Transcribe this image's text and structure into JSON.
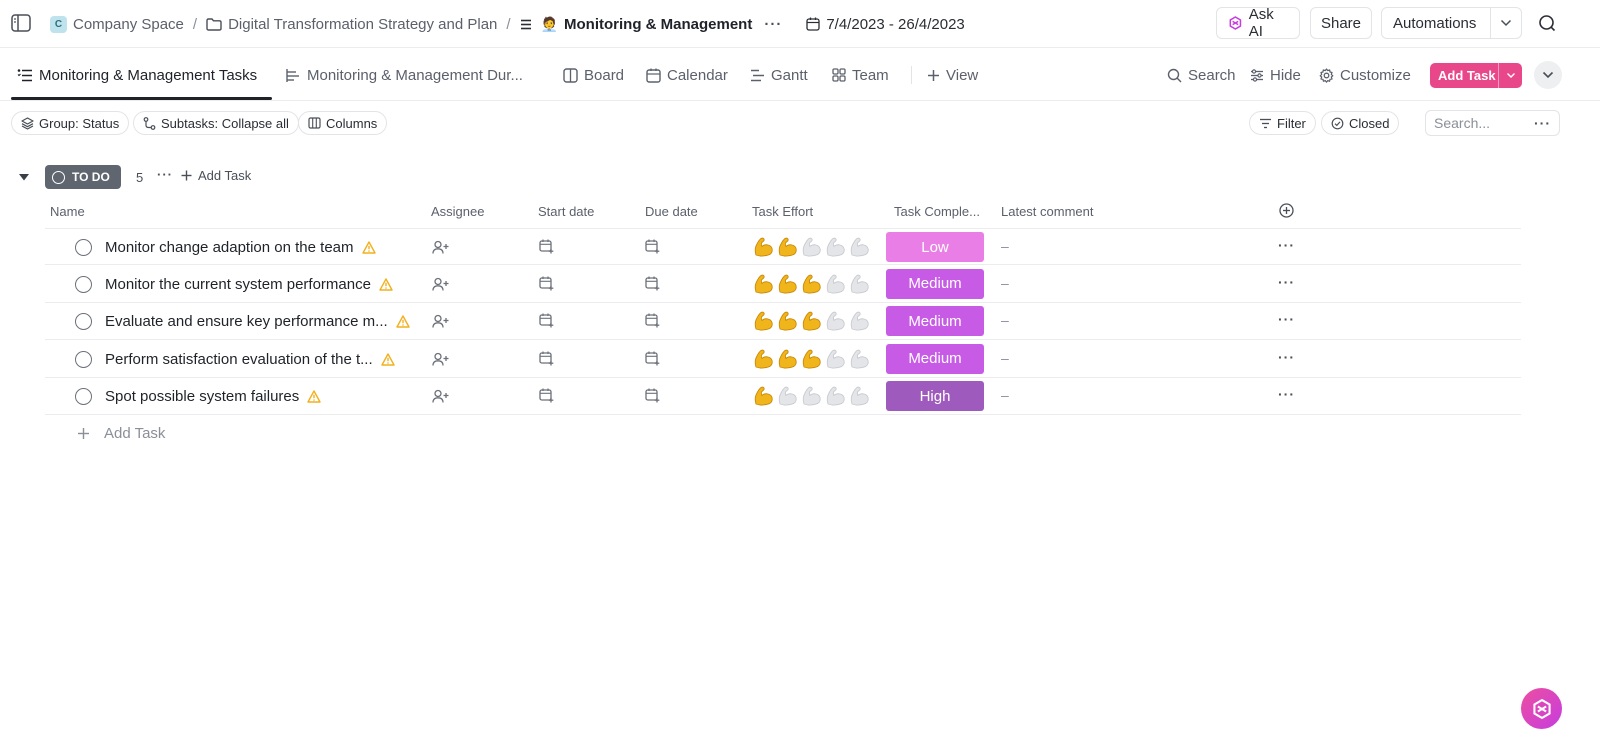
{
  "breadcrumb": {
    "space_initial": "C",
    "space": "Company Space",
    "separator": "/",
    "folder": "Digital Transformation Strategy and Plan",
    "list_emoji": "🧑‍💼",
    "list": "Monitoring & Management",
    "more": "···",
    "date_range": "7/4/2023 - 26/4/2023"
  },
  "topbar": {
    "ask_ai": "Ask AI",
    "share": "Share",
    "automations": "Automations"
  },
  "views": {
    "tabs": [
      {
        "label": "Monitoring & Management Tasks",
        "icon": "list-view-icon",
        "active": true
      },
      {
        "label": "Monitoring & Management Dur...",
        "icon": "gantt-list-icon",
        "active": false
      },
      {
        "label": "Board",
        "icon": "board-icon",
        "active": false
      },
      {
        "label": "Calendar",
        "icon": "calendar-icon",
        "active": false
      },
      {
        "label": "Gantt",
        "icon": "gantt-icon",
        "active": false
      },
      {
        "label": "Team",
        "icon": "team-grid-icon",
        "active": false
      }
    ],
    "add_view": "View",
    "search": "Search",
    "hide": "Hide",
    "customize": "Customize",
    "add_task": "Add Task"
  },
  "filters": {
    "group": "Group: Status",
    "subtasks": "Subtasks: Collapse all",
    "columns": "Columns",
    "filter": "Filter",
    "closed": "Closed",
    "search_placeholder": "Search...",
    "search_more": "···"
  },
  "group": {
    "status": "TO DO",
    "count": "5",
    "more": "···",
    "add_task": "Add Task"
  },
  "columns": {
    "name": "Name",
    "assignee": "Assignee",
    "start_date": "Start date",
    "due_date": "Due date",
    "task_effort": "Task Effort",
    "task_completion": "Task Comple...",
    "latest_comment": "Latest comment"
  },
  "tasks": [
    {
      "name": "Monitor change adaption on the team",
      "effort": 2,
      "completion": "Low",
      "completion_color": "#e97fe6",
      "comment": "–",
      "more": "···"
    },
    {
      "name": "Monitor the current system performance",
      "effort": 3,
      "completion": "Medium",
      "completion_color": "#c75be6",
      "comment": "–",
      "more": "···"
    },
    {
      "name": "Evaluate and ensure key performance m...",
      "effort": 3,
      "completion": "Medium",
      "completion_color": "#c75be6",
      "comment": "–",
      "more": "···"
    },
    {
      "name": "Perform satisfaction evaluation of the t...",
      "effort": 3,
      "completion": "Medium",
      "completion_color": "#c75be6",
      "comment": "–",
      "more": "···"
    },
    {
      "name": "Spot possible system failures",
      "effort": 1,
      "completion": "High",
      "completion_color": "#9e5bbd",
      "comment": "–",
      "more": "···"
    }
  ],
  "effort_max": 5,
  "footer": {
    "add_task": "Add Task"
  },
  "colors": {
    "accent": "#e8488a",
    "status_todo": "#5f6670",
    "warning": "#f2b01e"
  }
}
